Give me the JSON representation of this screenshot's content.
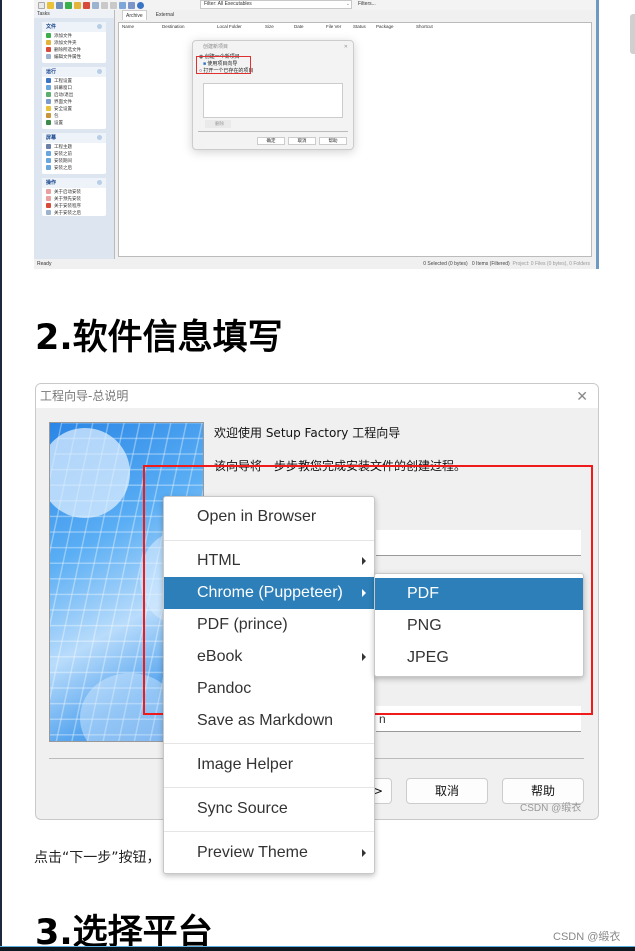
{
  "colors": {
    "menu_highlight": "#2c7fb9",
    "annotation_red": "#f01a1a",
    "toolbar_blue": "#6e9ac2"
  },
  "screenshot1": {
    "toolbar": {
      "filter_label": "Filter:",
      "filter_value": "All Executables",
      "filters_button": "Filters..."
    },
    "tasks_panel": {
      "title": "Tasks",
      "groups": [
        {
          "title": "文件",
          "items": [
            "添加文件",
            "添加文件夹",
            "删除所选文件",
            "编辑文件属性"
          ]
        },
        {
          "title": "运行",
          "items": [
            "工程设置",
            "屏幕窗口",
            "启动/退出",
            "界面文件",
            "安全设置",
            "包",
            "设置"
          ]
        },
        {
          "title": "屏幕",
          "items": [
            "工程主题",
            "安装之前",
            "安装期间",
            "安装之后"
          ]
        },
        {
          "title": "操作",
          "items": [
            "关于启动安装",
            "关于预先安装",
            "关于安装程序",
            "关于安装之后"
          ]
        }
      ]
    },
    "tabs": [
      {
        "label": "Archive",
        "active": true
      },
      {
        "label": "External",
        "active": false
      }
    ],
    "columns": [
      "Name",
      "Destination",
      "Local Folder",
      "Size",
      "Date",
      "File Ver",
      "Status",
      "Package",
      "Shortcut"
    ],
    "dialog": {
      "title": "创建新项目",
      "option1": "创建一个新项目",
      "checkbox": "使用项目向导",
      "option2": "打开一个已存在的项目",
      "delete_button": "删除",
      "ok": "确定",
      "cancel": "取消",
      "help": "帮助"
    },
    "status": {
      "left": "Ready",
      "selected": "0 Selected (0 bytes)",
      "items": "0 Items (Filtered)",
      "project": "Project: 0 Files (0 bytes), 0 Folders"
    }
  },
  "article": {
    "heading2": "2.软件信息填写",
    "paragraph_visible": "点击“下一步”按钮，",
    "heading3": "3.选择平台",
    "watermark": "CSDN @缎衣"
  },
  "wizard": {
    "title": "工程向导-总说明",
    "welcome": "欢迎使用 Setup Factory 工程向导",
    "description": "该向导将一步步教您完成安装文件的创建过程。",
    "input2_partial": "n",
    "next_button_partial": ">",
    "cancel_button": "取消",
    "help_button": "帮助",
    "watermark": "CSDN @缎衣"
  },
  "context_menu": {
    "items": [
      {
        "label": "Open in Browser",
        "submenu": false
      },
      {
        "label": "HTML",
        "submenu": true
      },
      {
        "label": "Chrome (Puppeteer)",
        "submenu": true,
        "highlighted": true
      },
      {
        "label": "PDF (prince)",
        "submenu": false
      },
      {
        "label": "eBook",
        "submenu": true
      },
      {
        "label": "Pandoc",
        "submenu": false
      },
      {
        "label": "Save as Markdown",
        "submenu": false
      },
      {
        "label": "Image Helper",
        "submenu": false
      },
      {
        "label": "Sync Source",
        "submenu": false
      },
      {
        "label": "Preview Theme",
        "submenu": true
      }
    ],
    "submenu": [
      {
        "label": "PDF",
        "highlighted": true
      },
      {
        "label": "PNG"
      },
      {
        "label": "JPEG"
      }
    ]
  }
}
